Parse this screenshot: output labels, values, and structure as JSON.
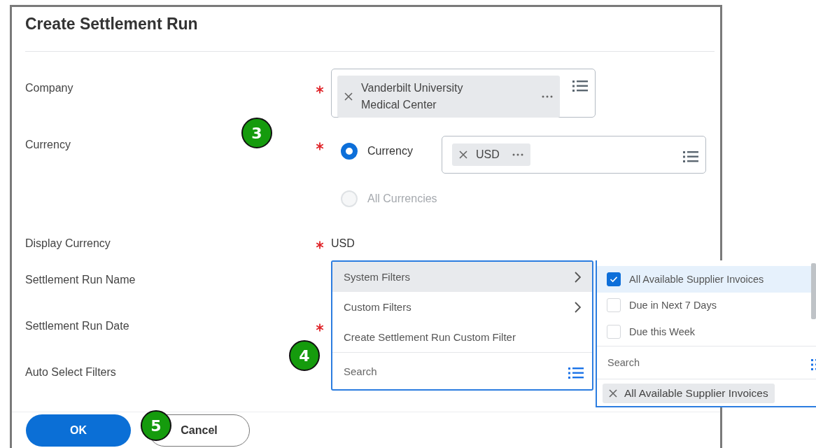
{
  "dialog": {
    "title": "Create Settlement Run"
  },
  "fields": [
    {
      "label": "Company",
      "required": true,
      "kind": "multiselect",
      "tokens": [
        {
          "text": "Vanderbilt University Medical Center"
        }
      ]
    },
    {
      "label": "Currency",
      "required": true,
      "kind": "radio",
      "options": [
        {
          "label": "Currency",
          "selected": true,
          "disabled": false,
          "tokens": [
            {
              "text": "USD"
            }
          ]
        },
        {
          "label": "All Currencies",
          "selected": false,
          "disabled": true
        }
      ]
    },
    {
      "label": "Display Currency",
      "required": true,
      "kind": "text",
      "value": "USD"
    },
    {
      "label": "Settlement Run Name",
      "required": false,
      "kind": "empty"
    },
    {
      "label": "Settlement Run Date",
      "required": true,
      "kind": "empty"
    },
    {
      "label": "Auto Select Filters",
      "required": false,
      "kind": "empty"
    }
  ],
  "menu": {
    "items": [
      {
        "label": "System Filters",
        "selected": true,
        "submenu": true
      },
      {
        "label": "Custom Filters",
        "selected": false,
        "submenu": true
      },
      {
        "label": "Create Settlement Run Custom Filter",
        "selected": false,
        "submenu": false
      }
    ],
    "search": {
      "placeholder": "Search"
    }
  },
  "submenu": {
    "options": [
      {
        "label": "All Available Supplier Invoices",
        "checked": true
      },
      {
        "label": "Due in Next 7 Days",
        "checked": false
      },
      {
        "label": "Due this Week",
        "checked": false
      }
    ],
    "search": {
      "placeholder": "Search"
    },
    "tokens": [
      {
        "text": "All Available Supplier Invoices"
      }
    ]
  },
  "buttons": [
    {
      "label": "OK",
      "kind": "primary"
    },
    {
      "label": "Cancel",
      "kind": "secondary"
    }
  ],
  "callouts": [
    {
      "text": "3"
    },
    {
      "text": "4"
    },
    {
      "text": "5"
    }
  ]
}
